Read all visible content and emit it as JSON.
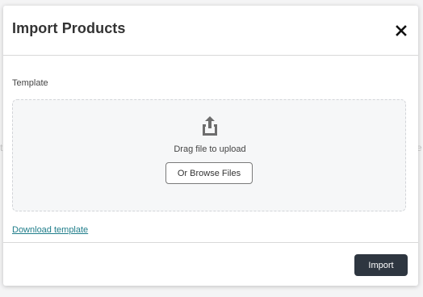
{
  "modal": {
    "title": "Import Products",
    "close_icon": "close-icon"
  },
  "template": {
    "label": "Template",
    "upload_icon": "upload-icon",
    "drag_text": "Drag file to upload",
    "browse_label": "Or Browse Files",
    "download_link": "Download template"
  },
  "footer": {
    "import_label": "Import"
  },
  "colors": {
    "primary_button": "#2e3640",
    "link": "#1f7d8a",
    "dropzone_bg": "#f6f7f8",
    "dropzone_border": "#d2d4d8"
  }
}
